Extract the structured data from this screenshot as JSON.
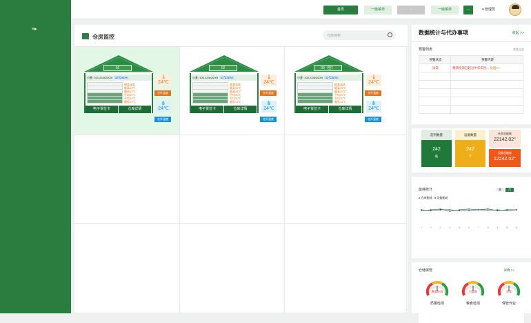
{
  "nav": {
    "sidebar_icon": "≡▸"
  },
  "topbar": {
    "btn_home": "首页",
    "btn_menu1": "一级菜单",
    "btn_gray": "-",
    "btn_menu2": "一级菜单",
    "btn_more": "···",
    "user": "管理员",
    "user_caret": "▾"
  },
  "main": {
    "title": "仓房监控",
    "search_placeholder": "仓房搜索"
  },
  "warehouse_shared": {
    "info": "小麦: 100.233t/2000t",
    "temp_humidity": "32℃/60%",
    "labels": [
      "粮表温度",
      "最高35℃",
      "最高35℃",
      "平均30℃",
      "平均30℃",
      "最低25℃"
    ],
    "temp_out": "24℃",
    "temp_in": "24℃",
    "tag_out": "仓外温度",
    "tag_in": "仓外湿度",
    "btn_card": "电子货位卡",
    "btn_detail": "仓库详情"
  },
  "warehouses": [
    {
      "name": "01"
    },
    {
      "name": "02"
    },
    {
      "name": "03（空）"
    }
  ],
  "right": {
    "title": "数据统计与代办事项",
    "collapse": "收起 >>",
    "alert": {
      "label": "预警列表",
      "more": "查看全部",
      "headers": [
        "预警状态",
        "预警内容"
      ],
      "rows": [
        {
          "status": "异常",
          "content": "粮情检测已超过半年未检...",
          "action": "处理>>"
        }
      ]
    },
    "stats": {
      "items": [
        {
          "label": "药剂数量",
          "value": "242",
          "unit": "吨"
        },
        {
          "label": "设备数量",
          "value": "242",
          "unit": "个"
        },
        {
          "label": "仓房总能耗",
          "value": "22142.02",
          "unit": "°"
        },
        {
          "label": "设备总能耗",
          "value": "12242.02",
          "unit": "°"
        }
      ]
    },
    "energy": {
      "title": "能耗统计",
      "tab_day": "周",
      "tab_month": "月",
      "legend": [
        "仓库能耗",
        "设备能耗"
      ],
      "colors": [
        "#2a7d3f",
        "#1f3a6b"
      ]
    },
    "storage": {
      "title": "仓储保管",
      "more": "详情 >>",
      "gauges": [
        {
          "label": "质量检测",
          "center": "覆盖检测"
        },
        {
          "label": "粮食检测",
          "center": "已超期"
        },
        {
          "label": "保管作业",
          "center": "异常"
        }
      ]
    }
  },
  "chart_data": {
    "type": "line",
    "x": [
      "1",
      "2",
      "3",
      "4",
      "5",
      "6",
      "7",
      "8",
      "9",
      "10",
      "11"
    ],
    "series": [
      {
        "name": "仓库能耗",
        "values": [
          11,
          12,
          13,
          10,
          12,
          13,
          12,
          11,
          12,
          11,
          12
        ]
      },
      {
        "name": "设备能耗",
        "values": [
          12,
          11,
          12,
          12,
          11,
          11,
          12,
          13,
          11,
          12,
          12
        ]
      }
    ],
    "ylim": [
      0,
      15
    ]
  }
}
